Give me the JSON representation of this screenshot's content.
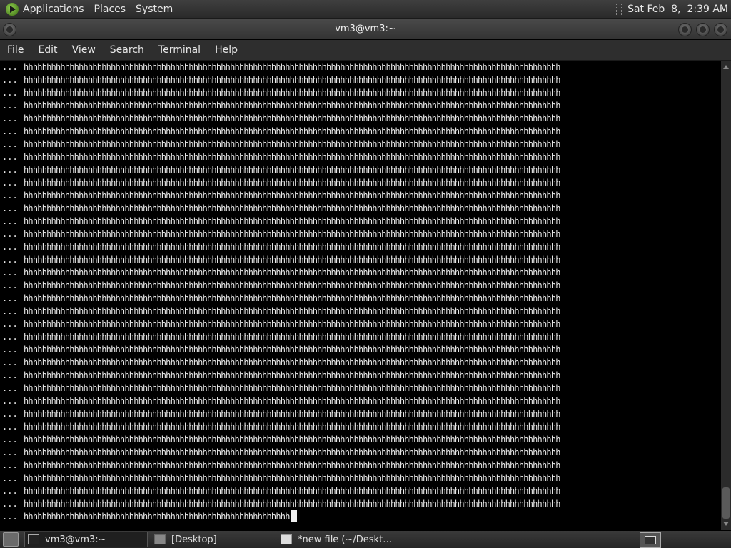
{
  "top_panel": {
    "menus": [
      "Applications",
      "Places",
      "System"
    ],
    "clock": "Sat Feb  8,  2:39 AM"
  },
  "window": {
    "title": "vm3@vm3:~"
  },
  "menubar": [
    "File",
    "Edit",
    "View",
    "Search",
    "Terminal",
    "Help"
  ],
  "terminal": {
    "prompt": "...",
    "full_line_count": 35,
    "h_per_full_line": 117,
    "h_in_last_line": 58
  },
  "taskbar": {
    "tasks": [
      {
        "label": "vm3@vm3:~",
        "icon": "terminal-icon",
        "active": true
      },
      {
        "label": "[Desktop]",
        "icon": "folder-icon",
        "active": false
      },
      {
        "label": "*new file (~/Deskto…",
        "icon": "text-editor-icon",
        "active": false
      }
    ]
  },
  "colors": {
    "terminal_bg": "#000000",
    "terminal_fg": "#e8e8e8",
    "panel_bg": "#2e2e2e"
  }
}
